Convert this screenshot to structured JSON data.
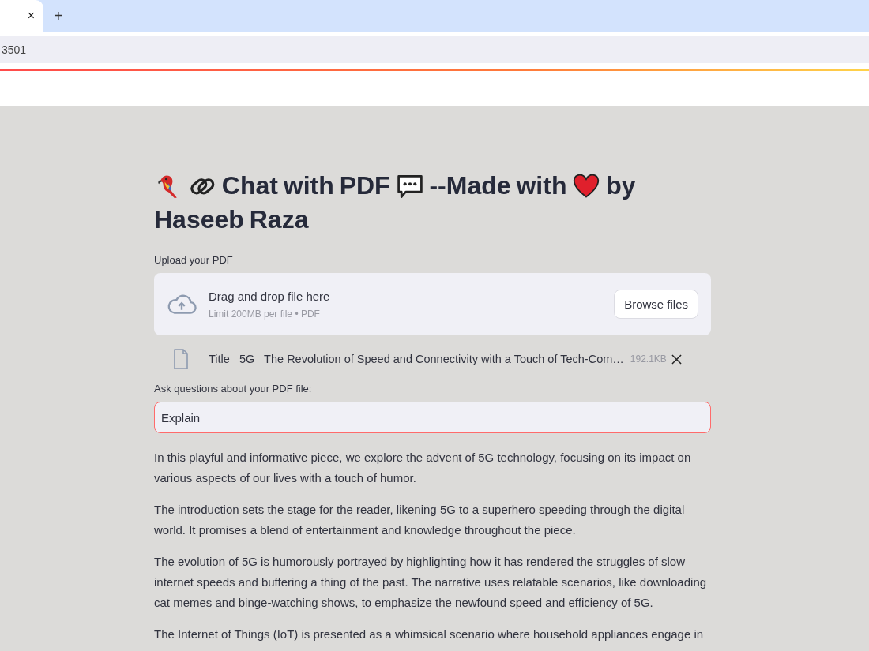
{
  "browser": {
    "tab_close": "×",
    "new_tab": "+",
    "address": "3501"
  },
  "title": {
    "part_1": "Chat with PDF",
    "part_2": "--Made with",
    "part_3": "by",
    "part_4": "Haseeb Raza"
  },
  "uploader": {
    "label": "Upload your PDF",
    "drop_text": "Drag and drop file here",
    "limit": "Limit 200MB per file • PDF",
    "button": "Browse files"
  },
  "file": {
    "name": "Title_ 5G_ The Revolution of Speed and Connectivity with a Touch of Tech-Com…",
    "size": "192.1KB"
  },
  "question": {
    "label": "Ask questions about your PDF file:",
    "value": "Explain",
    "focused": true
  },
  "answer": [
    "In this playful and informative piece, we explore the advent of 5G technology, focusing on its impact on various aspects of our lives with a touch of humor.",
    "The introduction sets the stage for the reader, likening 5G to a superhero speeding through the digital world. It promises a blend of entertainment and knowledge throughout the piece.",
    "The evolution of 5G is humorously portrayed by highlighting how it has rendered the struggles of slow internet speeds and buffering a thing of the past. The narrative uses relatable scenarios, like downloading cat memes and binge-watching shows, to emphasize the newfound speed and efficiency of 5G.",
    "The Internet of Things (IoT) is presented as a whimsical scenario where household appliances engage in"
  ]
}
